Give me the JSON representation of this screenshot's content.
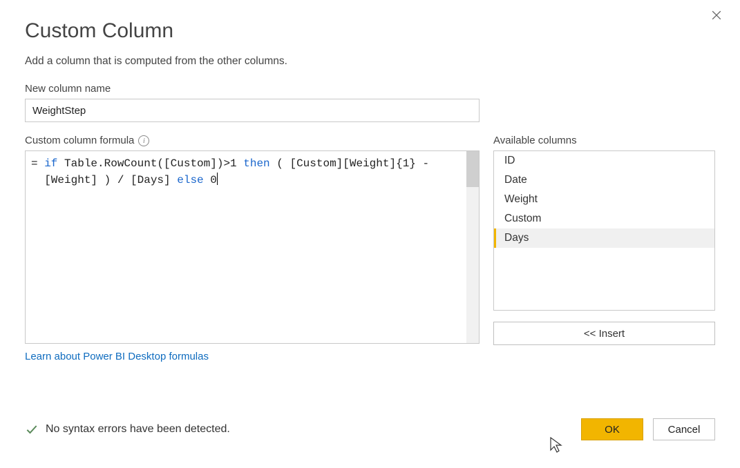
{
  "dialog": {
    "title": "Custom Column",
    "subtitle": "Add a column that is computed from the other columns.",
    "close_name": "close-icon"
  },
  "new_column": {
    "label": "New column name",
    "value": "WeightStep"
  },
  "formula": {
    "label": "Custom column formula",
    "prefix": "= ",
    "tokens": {
      "p1": "if",
      "p2": " Table.RowCount([Custom])>1 ",
      "p3": "then",
      "p4": " ( [Custom][Weight]{1} -",
      "p5": "[Weight] ) / [Days] ",
      "p6": "else",
      "p7": " 0"
    }
  },
  "available": {
    "label": "Available columns",
    "items": [
      "ID",
      "Date",
      "Weight",
      "Custom",
      "Days"
    ],
    "selected_index": 4,
    "insert_label": "<< Insert"
  },
  "link": {
    "text": "Learn about Power BI Desktop formulas"
  },
  "status": {
    "text": "No syntax errors have been detected."
  },
  "buttons": {
    "ok": "OK",
    "cancel": "Cancel"
  }
}
